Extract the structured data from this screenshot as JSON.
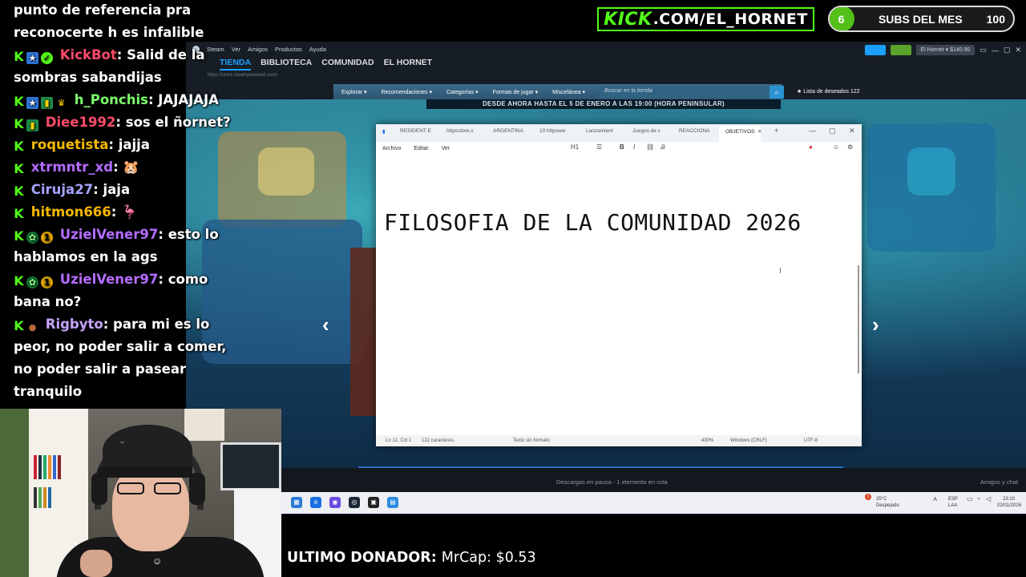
{
  "chat": {
    "partial_lines": [
      "punto de referencia pra",
      "reconocerte h es infalible"
    ],
    "messages": [
      {
        "user": "KickBot",
        "color": "#ff4b6b",
        "badges": [
          "kick",
          "sub",
          "verified"
        ],
        "text": ": Salid de la sombras sabandijas"
      },
      {
        "user": "h_Ponchis",
        "color": "#7cff6b",
        "badges": [
          "kick",
          "sub",
          "gift",
          "crown"
        ],
        "text": ": JAJAJAJA"
      },
      {
        "user": "Diee1992",
        "color": "#ff4b6b",
        "badges": [
          "kick",
          "gift"
        ],
        "text": ": sos el ñornet?"
      },
      {
        "user": "roquetista",
        "color": "#f5b800",
        "badges": [
          "kick"
        ],
        "text": ": jajja"
      },
      {
        "user": "xtrmntr_xd",
        "color": "#b46cff",
        "badges": [
          "kick"
        ],
        "text": ": 🐹"
      },
      {
        "user": "Ciruja27",
        "color": "#a3a3ff",
        "badges": [
          "kick"
        ],
        "text": ": jaja"
      },
      {
        "user": "hitmon666",
        "color": "#f5b800",
        "badges": [
          "kick"
        ],
        "text": ": 🦩"
      },
      {
        "user": "UzielVener97",
        "color": "#b46cff",
        "badges": [
          "kick",
          "og",
          "num"
        ],
        "text": ": esto lo hablamos en la ags"
      },
      {
        "user": "UzielVener97",
        "color": "#b46cff",
        "badges": [
          "kick",
          "og",
          "num"
        ],
        "text": ": como bana no?"
      },
      {
        "user": "Rigbyto",
        "color": "#c7a4ff",
        "badges": [
          "kick",
          "cup"
        ],
        "text": ": para mi es lo peor, no poder salir a comer, no poder salir a pasear tranquilo"
      }
    ]
  },
  "banner": {
    "kick_word": "KICK",
    "rest": ".COM/EL_HORNET"
  },
  "subs": {
    "count": "6",
    "label": "SUBS DEL MES",
    "goal": "100"
  },
  "steam": {
    "menu": [
      "Steam",
      "Ver",
      "Amigos",
      "Productos",
      "Ayuda"
    ],
    "nav": [
      "TIENDA",
      "BIBLIOTECA",
      "COMUNIDAD",
      "EL HORNET"
    ],
    "address": "https://store.steampowered.com/",
    "user_pill": "El Hornet ▾ $140.90",
    "store_bar": [
      "Explorar ▾",
      "Recomendaciones ▾",
      "Categorías ▾",
      "Formas de jugar ▾",
      "Miscelánea ▾"
    ],
    "search_placeholder": "Buscar en la tienda",
    "wishlist": "★ Lista de deseados 122",
    "promo": "DESDE AHORA HASTA EL 5 DE ENERO A LAS 19:00 (HORA PENINSULAR)",
    "download_status": "Descargas en pausa - 1 elemento en cola",
    "friends": "Amigos y chat"
  },
  "notepad": {
    "tabs": [
      "RESIDENT E",
      "httpsstore.s",
      "ARGENTINA",
      "10 httpsww",
      "Lanzamient",
      "Juegos de c",
      "REACCIONA",
      "OBJETIVOS"
    ],
    "menu": [
      "Archivo",
      "Editar",
      "Ver"
    ],
    "heading_level": "H1",
    "content": "FILOSOFIA DE LA COMUNIDAD 2026",
    "status": {
      "position": "Ln 12, Col 1",
      "chars": "122 caracteres.",
      "format": "Texto sin formato",
      "zoom": "430%",
      "eol": "Windows (CRLF)",
      "encoding": "UTF-8"
    }
  },
  "taskbar": {
    "weather_temp": "25°C",
    "weather_desc": "Despejado",
    "notif_count": "3",
    "lang_top": "ESP",
    "lang_bottom": "LAA",
    "time": "23:10",
    "date": "02/01/2026"
  },
  "donor": {
    "label": "ULTIMO DONADOR:",
    "value": "MrCap: $0.53"
  },
  "colors": {
    "kick_green": "#53fc18",
    "steam_blue": "#1a9fff"
  }
}
